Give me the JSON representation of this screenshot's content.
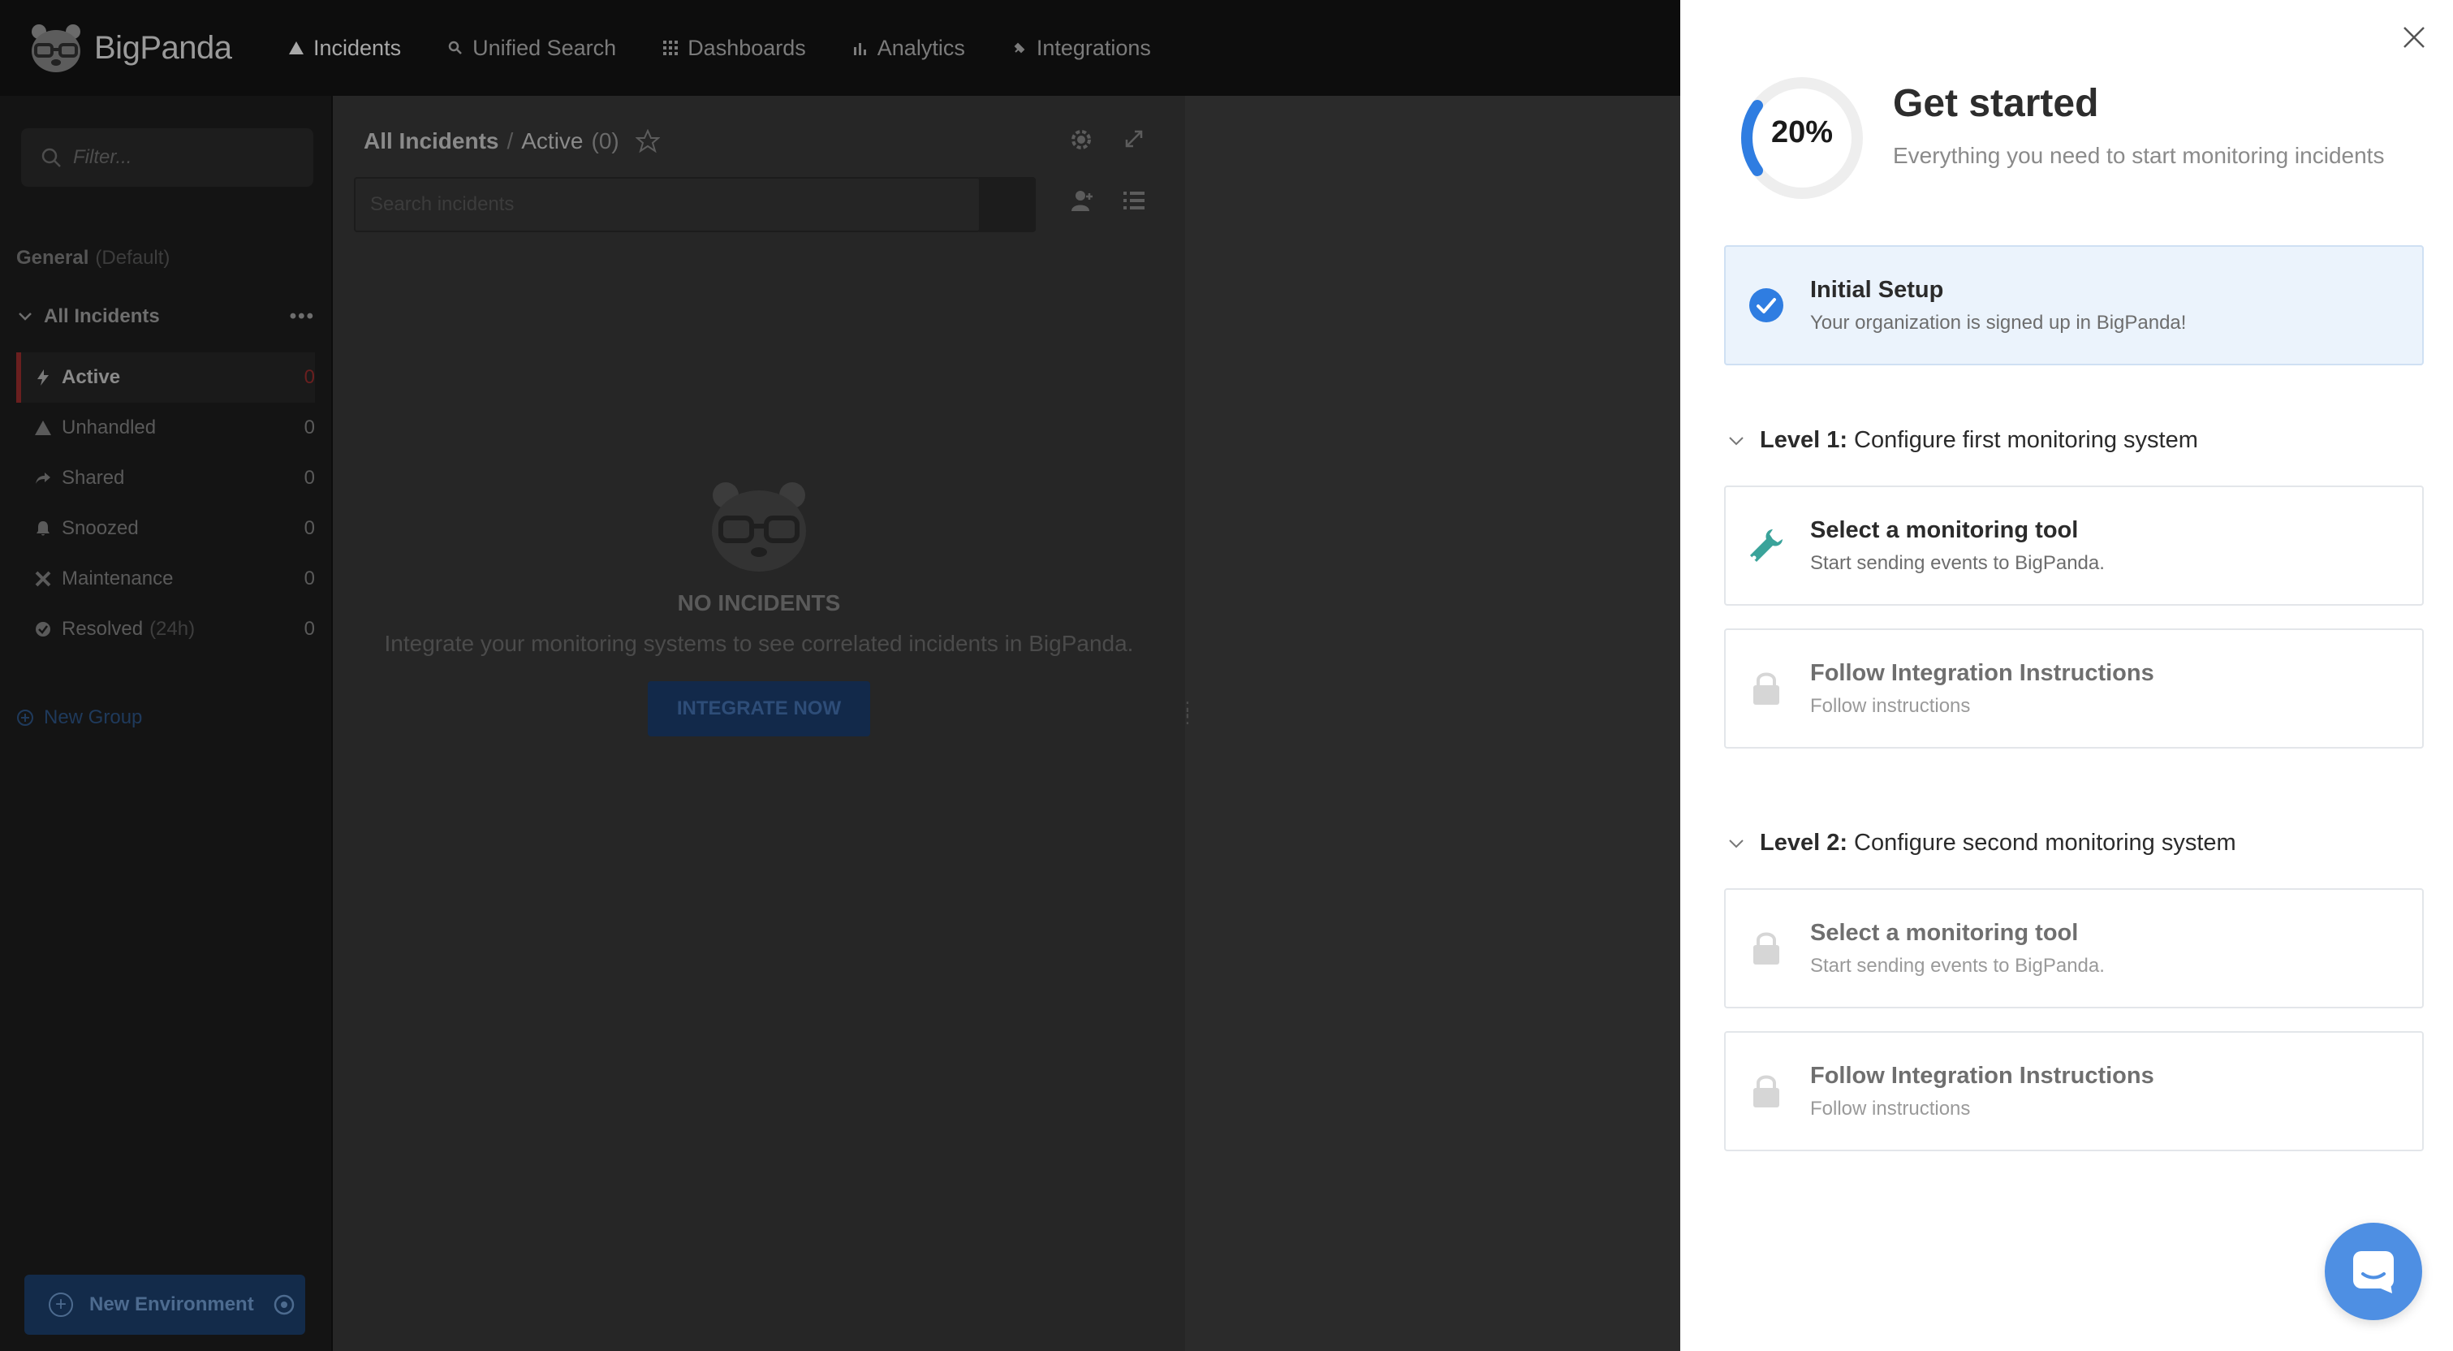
{
  "app": {
    "brand": "BigPanda",
    "nav": [
      {
        "label": "Incidents",
        "icon": "warning-icon",
        "active": true
      },
      {
        "label": "Unified Search",
        "icon": "search-icon"
      },
      {
        "label": "Dashboards",
        "icon": "grid-icon"
      },
      {
        "label": "Analytics",
        "icon": "bar-chart-icon"
      },
      {
        "label": "Integrations",
        "icon": "plug-icon"
      }
    ]
  },
  "sidebar": {
    "filter_placeholder": "Filter...",
    "group_name": "General",
    "group_tag": "(Default)",
    "all_incidents": "All Incidents",
    "more": "•••",
    "folders": [
      {
        "label": "Active",
        "count": "0",
        "icon": "bolt-icon",
        "selected": true
      },
      {
        "label": "Unhandled",
        "count": "0",
        "icon": "warning-icon"
      },
      {
        "label": "Shared",
        "count": "0",
        "icon": "share-icon"
      },
      {
        "label": "Snoozed",
        "count": "0",
        "icon": "bell-icon"
      },
      {
        "label": "Maintenance",
        "count": "0",
        "icon": "tools-icon"
      },
      {
        "label": "Resolved",
        "sub": "(24h)",
        "count": "0",
        "icon": "check-circle-icon"
      }
    ],
    "new_group": "New Group",
    "new_environment": "New Environment"
  },
  "panel": {
    "breadcrumb_root": "All Incidents",
    "breadcrumb_sep": "/",
    "breadcrumb_current": "Active",
    "count": "(0)",
    "search_placeholder": "Search incidents",
    "empty_title": "NO INCIDENTS",
    "empty_text": "Integrate your monitoring systems to see correlated incidents in BigPanda.",
    "integrate_button": "INTEGRATE NOW"
  },
  "drawer": {
    "progress_label": "20%",
    "progress_value": 0.2,
    "title": "Get started",
    "subtitle": "Everything you need to start monitoring incidents",
    "initial": {
      "title": "Initial Setup",
      "subtitle": "Your organization is signed up in BigPanda!"
    },
    "level1": {
      "prefix": "Level 1:",
      "title": "Configure first monitoring system"
    },
    "level1_steps": [
      {
        "title": "Select a monitoring tool",
        "subtitle": "Start sending events to BigPanda.",
        "state": "available"
      },
      {
        "title": "Follow Integration Instructions",
        "subtitle": "Follow instructions",
        "state": "locked"
      }
    ],
    "level2": {
      "prefix": "Level 2:",
      "title": "Configure second monitoring system"
    },
    "level2_steps": [
      {
        "title": "Select a monitoring tool",
        "subtitle": "Start sending events to BigPanda.",
        "state": "locked"
      },
      {
        "title": "Follow Integration Instructions",
        "subtitle": "Follow instructions",
        "state": "locked"
      }
    ]
  },
  "colors": {
    "accent_blue": "#2f7de1",
    "progress_track": "#eeeeee",
    "wrench_green": "#3aa39a",
    "lock_gray": "#d6d6d6",
    "chat_blue": "#4e8fe3"
  }
}
